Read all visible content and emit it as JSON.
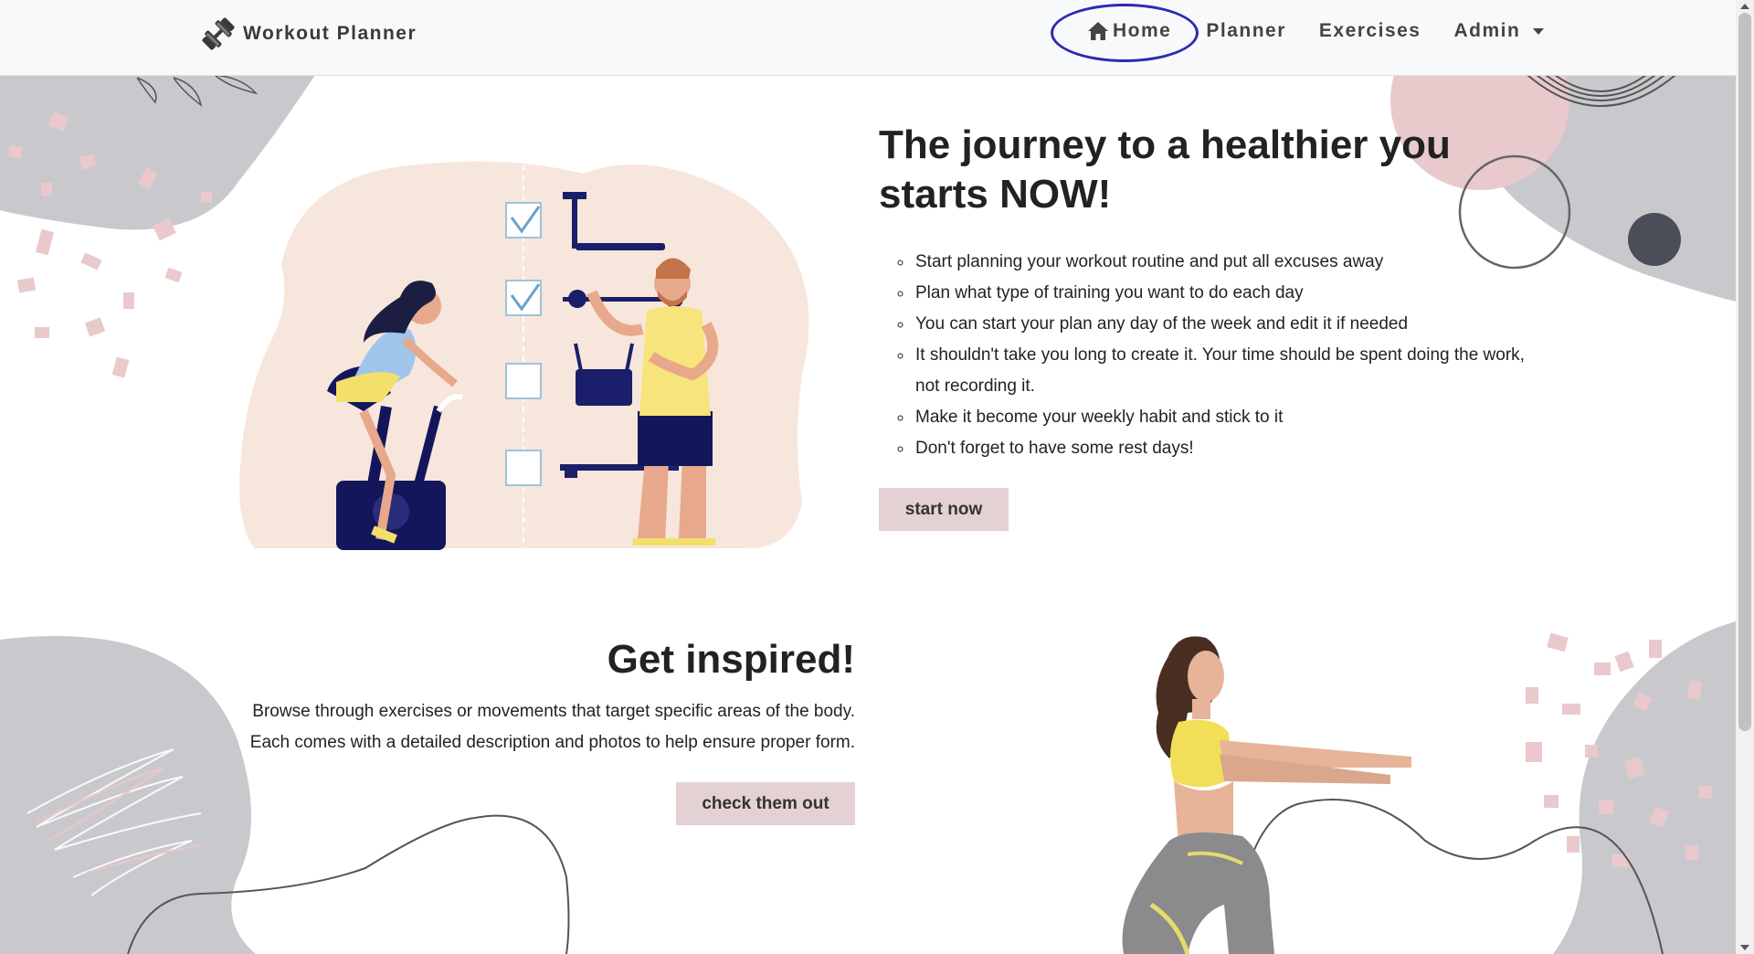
{
  "navbar": {
    "brand": "Workout Planner",
    "brand_icon": "dumbbell-icon",
    "items": [
      {
        "label": "Home",
        "icon": "home-icon",
        "active": true
      },
      {
        "label": "Planner"
      },
      {
        "label": "Exercises"
      },
      {
        "label": "Admin",
        "dropdown": true
      }
    ]
  },
  "hero": {
    "title": "The journey to a healthier you starts NOW!",
    "bullets": [
      "Start planning your workout routine and put all excuses away",
      "Plan what type of training you want to do each day",
      "You can start your plan any day of the week and edit it if needed",
      "It shouldn't take you long to create it. Your time should be spent doing the work, not recording it.",
      "Make it become your weekly habit and stick to it",
      "Don't forget to have some rest days!"
    ],
    "button": "start now"
  },
  "inspired": {
    "title": "Get inspired!",
    "line1": "Browse through exercises or movements that target specific areas of the body.",
    "line2": "Each comes with a detailed description and photos to help ensure proper form.",
    "button": "check them out"
  },
  "colors": {
    "accent": "#e3d1d3",
    "blob_gray": "#c8c8cc",
    "blob_pink": "#e8c9cc",
    "navy": "#12145a",
    "annotation_ring": "#2b2bb0"
  }
}
